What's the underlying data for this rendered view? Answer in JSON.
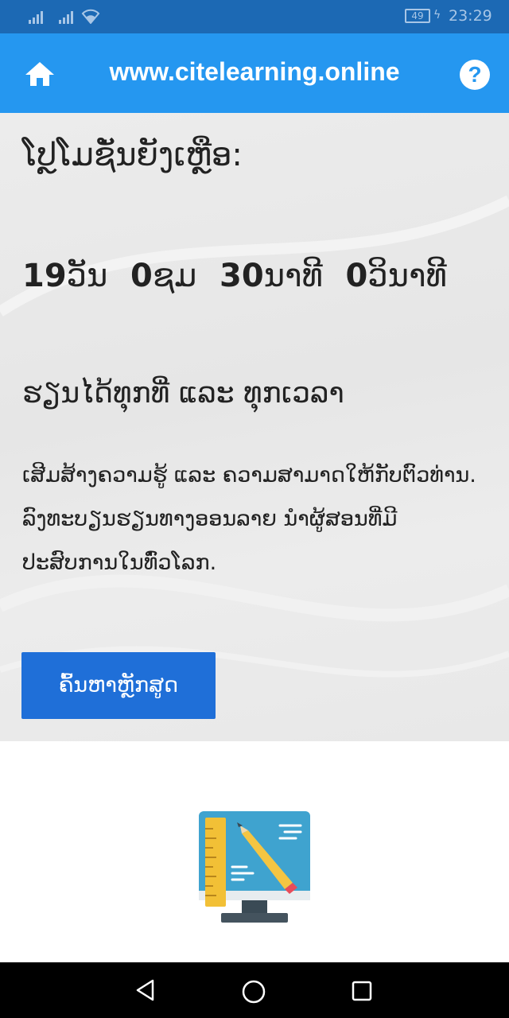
{
  "status_bar": {
    "time": "23:29",
    "battery_level": "49"
  },
  "app_bar": {
    "title": "www.citelearning.online",
    "help_label": "?"
  },
  "hero": {
    "heading": "ໂປຼໂມຊັ່ນຍັງເຫຼືອ:",
    "countdown": [
      {
        "value": "19",
        "unit": "ວັນ"
      },
      {
        "value": "0",
        "unit": "ຊມ"
      },
      {
        "value": "30",
        "unit": "ນາທີ"
      },
      {
        "value": "0",
        "unit": "ວິນາທີ"
      }
    ],
    "tagline": "ຮຽນໄດ້ທຸກທີ່ ແລະ ທຸກເວລາ",
    "description_lines": [
      "ເສີມສ້າງຄວາມຮູ້ ແລະ ຄວາມສາມາດໃຫ້ກັບຕົວທ່ານ.",
      "ລົງທະບຽນຮຽນທາງອອນລາຍ ນໍາຜູ້ສອນທີ່ມີປະສົບການໃນທົ່ວໂລກ."
    ],
    "search_button": "ຄົ້ນຫາຫຼັກສູດ"
  },
  "colors": {
    "status_bar": "#1c69b4",
    "app_bar": "#2597f0",
    "button": "#1f6fd8",
    "hero_background": "#ebebeb"
  },
  "icons": {
    "home": "home-icon",
    "help": "help-icon",
    "illustration": "computer-design-icon",
    "nav_back": "back-triangle-icon",
    "nav_home": "home-circle-icon",
    "nav_recent": "recent-square-icon"
  }
}
